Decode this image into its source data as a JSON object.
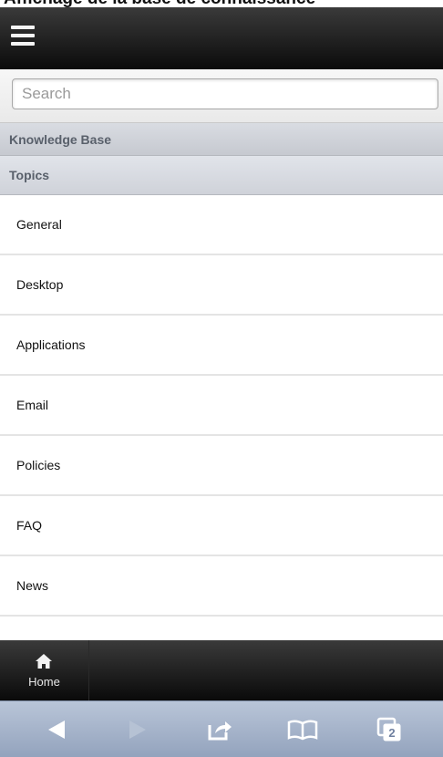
{
  "caption": "Affichage de la base de connaissance",
  "header": {
    "menu_icon": "hamburger-menu-icon"
  },
  "search": {
    "placeholder": "Search",
    "value": ""
  },
  "dividers": {
    "knowledge_base": "Knowledge Base",
    "topics": "Topics"
  },
  "topics": [
    "General",
    "Desktop",
    "Applications",
    "Email",
    "Policies",
    "FAQ",
    "News"
  ],
  "tabbar": {
    "home_label": "Home",
    "home_icon": "home-icon"
  },
  "browser_toolbar": {
    "back_icon": "back-arrow-icon",
    "forward_icon": "forward-arrow-icon",
    "share_icon": "share-icon",
    "bookmarks_icon": "bookmarks-icon",
    "tabs_icon": "tabs-icon",
    "tabs_count": "2"
  },
  "colors": {
    "header_bg": "#111111",
    "divider_bg": "#cfd2d9",
    "toolbar_bg": "#a8b6cc"
  }
}
